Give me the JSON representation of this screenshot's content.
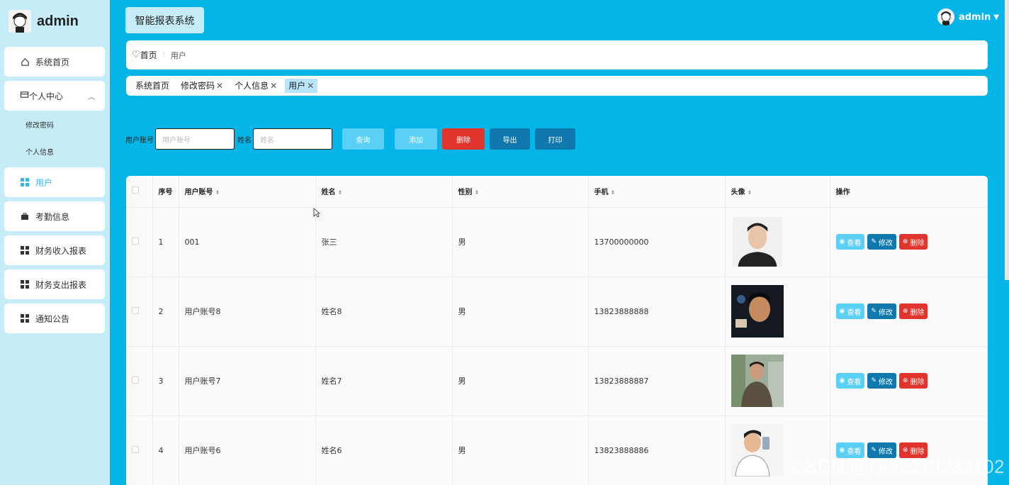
{
  "brand": {
    "title": "admin"
  },
  "sidebar": {
    "items": [
      {
        "label": "系统首页",
        "icon": "home-icon"
      },
      {
        "label": "个人中心",
        "icon": "wallet-icon",
        "sub": [
          {
            "label": "修改密码"
          },
          {
            "label": "个人信息"
          }
        ]
      },
      {
        "label": "用户",
        "icon": "grid-icon",
        "active": true
      },
      {
        "label": "考勤信息",
        "icon": "briefcase-icon"
      },
      {
        "label": "财务收入报表",
        "icon": "grid-icon"
      },
      {
        "label": "财务支出报表",
        "icon": "grid-icon"
      },
      {
        "label": "通知公告",
        "icon": "grid-icon"
      }
    ]
  },
  "header": {
    "system_title": "智能报表系统",
    "user": "admin"
  },
  "breadcrumb": {
    "home": "首页",
    "current": "用户"
  },
  "tabs": [
    {
      "label": "系统首页",
      "closable": false
    },
    {
      "label": "修改密码",
      "closable": true
    },
    {
      "label": "个人信息",
      "closable": true
    },
    {
      "label": "用户",
      "closable": true,
      "active": true
    }
  ],
  "search": {
    "account_label": "用户账号",
    "account_placeholder": "用户账号",
    "name_label": "姓名",
    "name_placeholder": "姓名",
    "buttons": {
      "query": "查询",
      "add": "添加",
      "delete": "删除",
      "export": "导出",
      "print": "打印"
    }
  },
  "table": {
    "columns": [
      "序号",
      "用户账号",
      "姓名",
      "性别",
      "手机",
      "头像",
      "操作"
    ],
    "rows": [
      {
        "index": "1",
        "account": "001",
        "name": "张三",
        "gender": "男",
        "phone": "13700000000"
      },
      {
        "index": "2",
        "account": "用户账号8",
        "name": "姓名8",
        "gender": "男",
        "phone": "13823888888"
      },
      {
        "index": "3",
        "account": "用户账号7",
        "name": "姓名7",
        "gender": "男",
        "phone": "13823888887"
      },
      {
        "index": "4",
        "account": "用户账号6",
        "name": "姓名6",
        "gender": "男",
        "phone": "13823888886"
      }
    ],
    "actions": {
      "view": "查看",
      "edit": "修改",
      "delete": "删除"
    }
  },
  "watermark": "CSDN @QQ2279239102",
  "colors": {
    "background": "#05b5e8",
    "sidebar": "#c6ecf8",
    "accent": "#36b6f0",
    "danger": "#e1342c",
    "primary": "#1178ad",
    "light": "#5bd0f4"
  }
}
